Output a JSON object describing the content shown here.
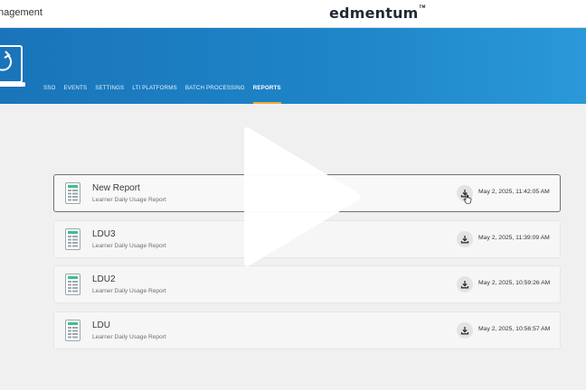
{
  "header": {
    "app_title": "nagement",
    "logo_text": "edmentum",
    "logo_mark": "TM"
  },
  "banner": {
    "gradient_colors": [
      "#1a74b9",
      "#2a98d9"
    ],
    "icon": "laptop-refresh-icon"
  },
  "nav": {
    "tabs": [
      {
        "label": "SSO",
        "active": false
      },
      {
        "label": "EVENTS",
        "active": false
      },
      {
        "label": "SETTINGS",
        "active": false
      },
      {
        "label": "LTI PLATFORMS",
        "active": false
      },
      {
        "label": "BATCH PROCESSING",
        "active": false
      },
      {
        "label": "REPORTS",
        "active": true
      }
    ],
    "active_underline_color": "#f2a73a"
  },
  "reports": [
    {
      "name": "New Report",
      "type": "Learner Daily Usage Report",
      "date": "May 2, 2025, 11:42:05 AM",
      "selected": true
    },
    {
      "name": "LDU3",
      "type": "Learner Daily Usage Report",
      "date": "May 2, 2025, 11:39:09 AM",
      "selected": false
    },
    {
      "name": "LDU2",
      "type": "Learner Daily Usage Report",
      "date": "May 2, 2025, 10:59:26 AM",
      "selected": false
    },
    {
      "name": "LDU",
      "type": "Learner Daily Usage Report",
      "date": "May 2, 2025, 10:56:57 AM",
      "selected": false
    }
  ],
  "icons": {
    "report": "spreadsheet-document-icon",
    "download": "download-icon",
    "cursor": "hand-pointer-icon",
    "video": "play-icon"
  }
}
